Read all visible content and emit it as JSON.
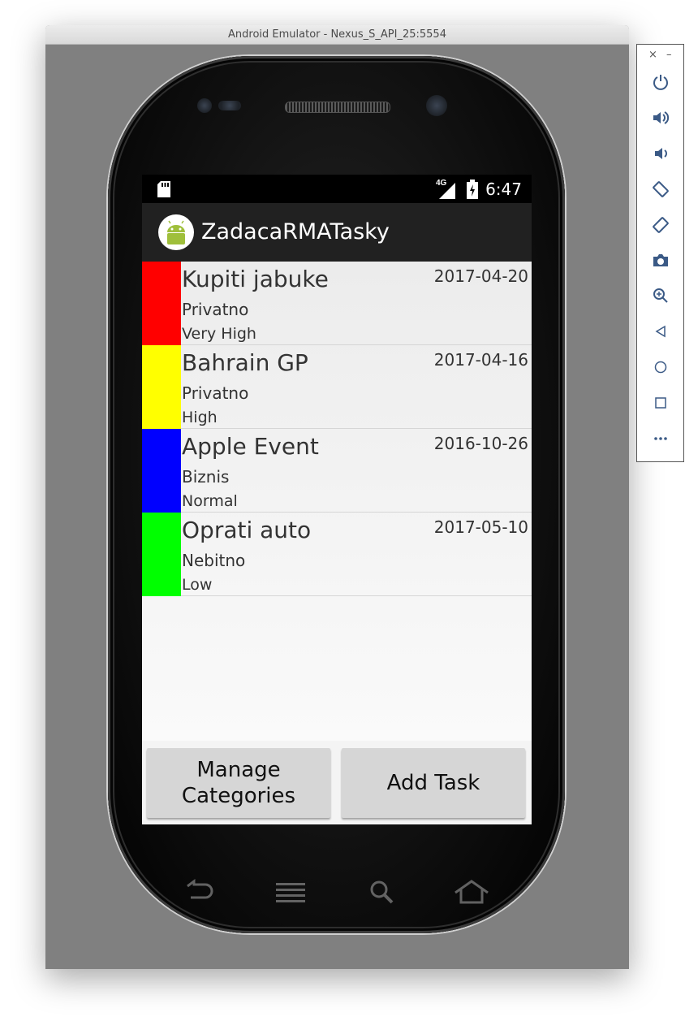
{
  "window": {
    "title": "Android Emulator - Nexus_S_API_25:5554"
  },
  "status_bar": {
    "network": "4G",
    "time": "6:47"
  },
  "app_bar": {
    "title": "ZadacaRMATasky"
  },
  "tasks": [
    {
      "title": "Kupiti jabuke",
      "category": "Privatno",
      "priority": "Very High",
      "date": "2017-04-20",
      "color": "#ff0000"
    },
    {
      "title": "Bahrain GP",
      "category": "Privatno",
      "priority": "High",
      "date": "2017-04-16",
      "color": "#ffff00"
    },
    {
      "title": "Apple Event",
      "category": "Biznis",
      "priority": "Normal",
      "date": "2016-10-26",
      "color": "#0000ff"
    },
    {
      "title": "Oprati auto",
      "category": "Nebitno",
      "priority": "Low",
      "date": "2017-05-10",
      "color": "#00ff00"
    }
  ],
  "buttons": {
    "manage_categories": "Manage Categories",
    "add_task": "Add Task"
  },
  "side_panel": {
    "close": "×",
    "minimize": "–"
  },
  "icons": {
    "status": [
      "sd-card-icon",
      "signal-icon",
      "battery-charging-icon"
    ],
    "nav": [
      "back-icon",
      "menu-icon",
      "search-icon",
      "home-icon"
    ],
    "side": [
      "power-icon",
      "volume-up-icon",
      "volume-down-icon",
      "rotate-left-icon",
      "rotate-right-icon",
      "camera-icon",
      "zoom-icon",
      "back-icon",
      "home-icon",
      "overview-icon",
      "more-icon"
    ]
  }
}
